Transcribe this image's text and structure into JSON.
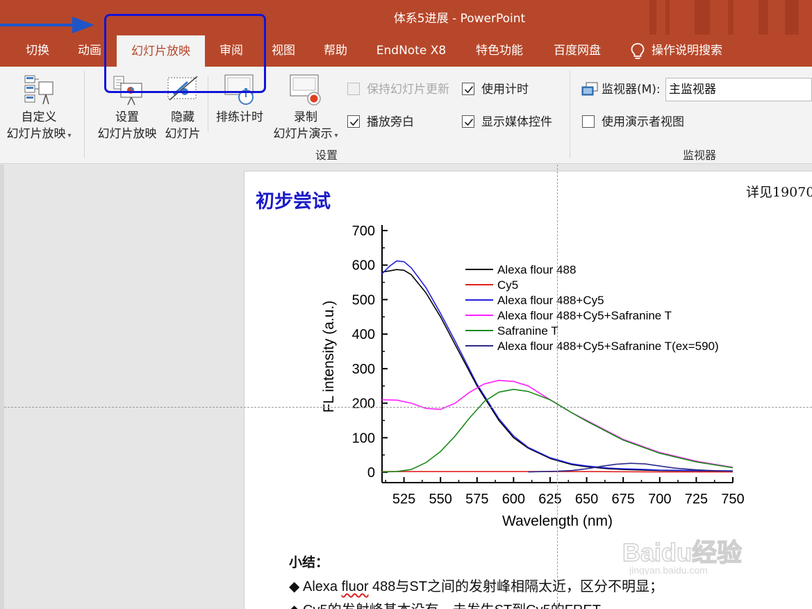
{
  "window": {
    "title": "体系5进展  -  PowerPoint"
  },
  "tabs": [
    {
      "label": "切换",
      "active": false
    },
    {
      "label": "动画",
      "active": false
    },
    {
      "label": "幻灯片放映",
      "active": true
    },
    {
      "label": "审阅",
      "active": false
    },
    {
      "label": "视图",
      "active": false
    },
    {
      "label": "帮助",
      "active": false
    },
    {
      "label": "EndNote X8",
      "active": false
    },
    {
      "label": "特色功能",
      "active": false
    },
    {
      "label": "百度网盘",
      "active": false
    },
    {
      "label": "操作说明搜索",
      "active": false
    }
  ],
  "ribbon": {
    "custom_show": {
      "line1": "自定义",
      "line2": "幻灯片放映"
    },
    "setup_show": {
      "line1": "设置",
      "line2": "幻灯片放映"
    },
    "hide_slide": {
      "line1": "隐藏",
      "line2": "幻灯片"
    },
    "rehearse": {
      "label": "排练计时"
    },
    "record": {
      "line1": "录制",
      "line2": "幻灯片演示"
    },
    "checkboxes": {
      "keep_updated": {
        "label": "保持幻灯片更新",
        "checked": false,
        "disabled": true
      },
      "use_timings": {
        "label": "使用计时",
        "checked": true
      },
      "play_narrations": {
        "label": "播放旁白",
        "checked": true
      },
      "show_media_controls": {
        "label": "显示媒体控件",
        "checked": true
      },
      "presenter_view": {
        "label": "使用演示者视图",
        "checked": false
      }
    },
    "monitor_label": "监视器(M):",
    "monitor_value": "主监视器",
    "groups": {
      "setup": "设置",
      "monitors": "监视器"
    }
  },
  "slide": {
    "title": "初步尝试",
    "note": "详见19070",
    "summary_title": "小结：",
    "bullets": [
      {
        "symbol": "◆",
        "prefix": "Alexa ",
        "flagged": "fluor",
        "rest": " 488与ST之间的发射峰相隔太近，区分不明显；"
      },
      {
        "symbol": "◆",
        "prefix": "Cy5的发射峰基本没有，未发生ST到Cy5的FRET",
        "flagged": "",
        "rest": ""
      }
    ]
  },
  "watermark": {
    "text": "Baidu经验",
    "subtext": "jingyan.baidu.com"
  },
  "colors": {
    "accent": "#b7472a",
    "annotation": "#1414d8",
    "slide_title": "#1a1ac8"
  },
  "chart_data": {
    "type": "line",
    "xlabel": "Wavelength (nm)",
    "ylabel": "FL intensity (a.u.)",
    "xlim": [
      510,
      750
    ],
    "ylim": [
      -30,
      700
    ],
    "xticks": [
      525,
      550,
      575,
      600,
      625,
      650,
      675,
      700,
      725,
      750
    ],
    "yticks": [
      0,
      100,
      200,
      300,
      400,
      500,
      600,
      700
    ],
    "legend_position": "top-right",
    "grid": false,
    "series": [
      {
        "name": "Alexa flour 488",
        "color": "#000000",
        "x": [
          510,
          515,
          520,
          525,
          530,
          540,
          550,
          560,
          575,
          590,
          600,
          610,
          625,
          640,
          650,
          665,
          675,
          690,
          700,
          725,
          750
        ],
        "y": [
          580,
          583,
          587,
          585,
          572,
          520,
          450,
          370,
          250,
          150,
          100,
          70,
          40,
          22,
          16,
          10,
          8,
          6,
          5,
          4,
          3
        ]
      },
      {
        "name": "Cy5",
        "color": "#e02020",
        "x": [
          510,
          550,
          600,
          650,
          700,
          750
        ],
        "y": [
          2,
          2,
          2,
          2,
          1,
          1
        ]
      },
      {
        "name": "Alexa flour 488+Cy5",
        "color": "#2020e0",
        "x": [
          510,
          515,
          520,
          525,
          530,
          540,
          550,
          560,
          575,
          590,
          600,
          610,
          625,
          640,
          650,
          665,
          675,
          690,
          700,
          725,
          750
        ],
        "y": [
          575,
          596,
          612,
          610,
          592,
          535,
          460,
          380,
          255,
          155,
          105,
          72,
          42,
          24,
          18,
          12,
          10,
          8,
          6,
          5,
          4
        ]
      },
      {
        "name": "Alexa flour 488+Cy5+Safranine T",
        "color": "#ff20ff",
        "x": [
          510,
          520,
          530,
          540,
          550,
          560,
          570,
          580,
          590,
          600,
          610,
          625,
          640,
          650,
          675,
          700,
          725,
          750
        ],
        "y": [
          210,
          209,
          200,
          185,
          182,
          200,
          232,
          256,
          266,
          263,
          250,
          210,
          172,
          150,
          95,
          57,
          32,
          14
        ]
      },
      {
        "name": "Safranine T",
        "color": "#1a8a1a",
        "x": [
          510,
          520,
          530,
          540,
          550,
          560,
          570,
          580,
          590,
          600,
          610,
          625,
          640,
          650,
          675,
          700,
          725,
          750
        ],
        "y": [
          1,
          2,
          8,
          28,
          60,
          105,
          158,
          205,
          232,
          240,
          234,
          210,
          172,
          148,
          93,
          55,
          30,
          13
        ]
      },
      {
        "name": "Alexa flour 488+Cy5+Safranine T(ex=590)",
        "color": "#2a2a8a",
        "x": [
          610,
          620,
          630,
          640,
          650,
          660,
          670,
          680,
          690,
          700,
          710,
          725,
          740,
          750
        ],
        "y": [
          1,
          2,
          3,
          5,
          10,
          17,
          23,
          26,
          24,
          18,
          12,
          7,
          4,
          3
        ]
      }
    ]
  }
}
